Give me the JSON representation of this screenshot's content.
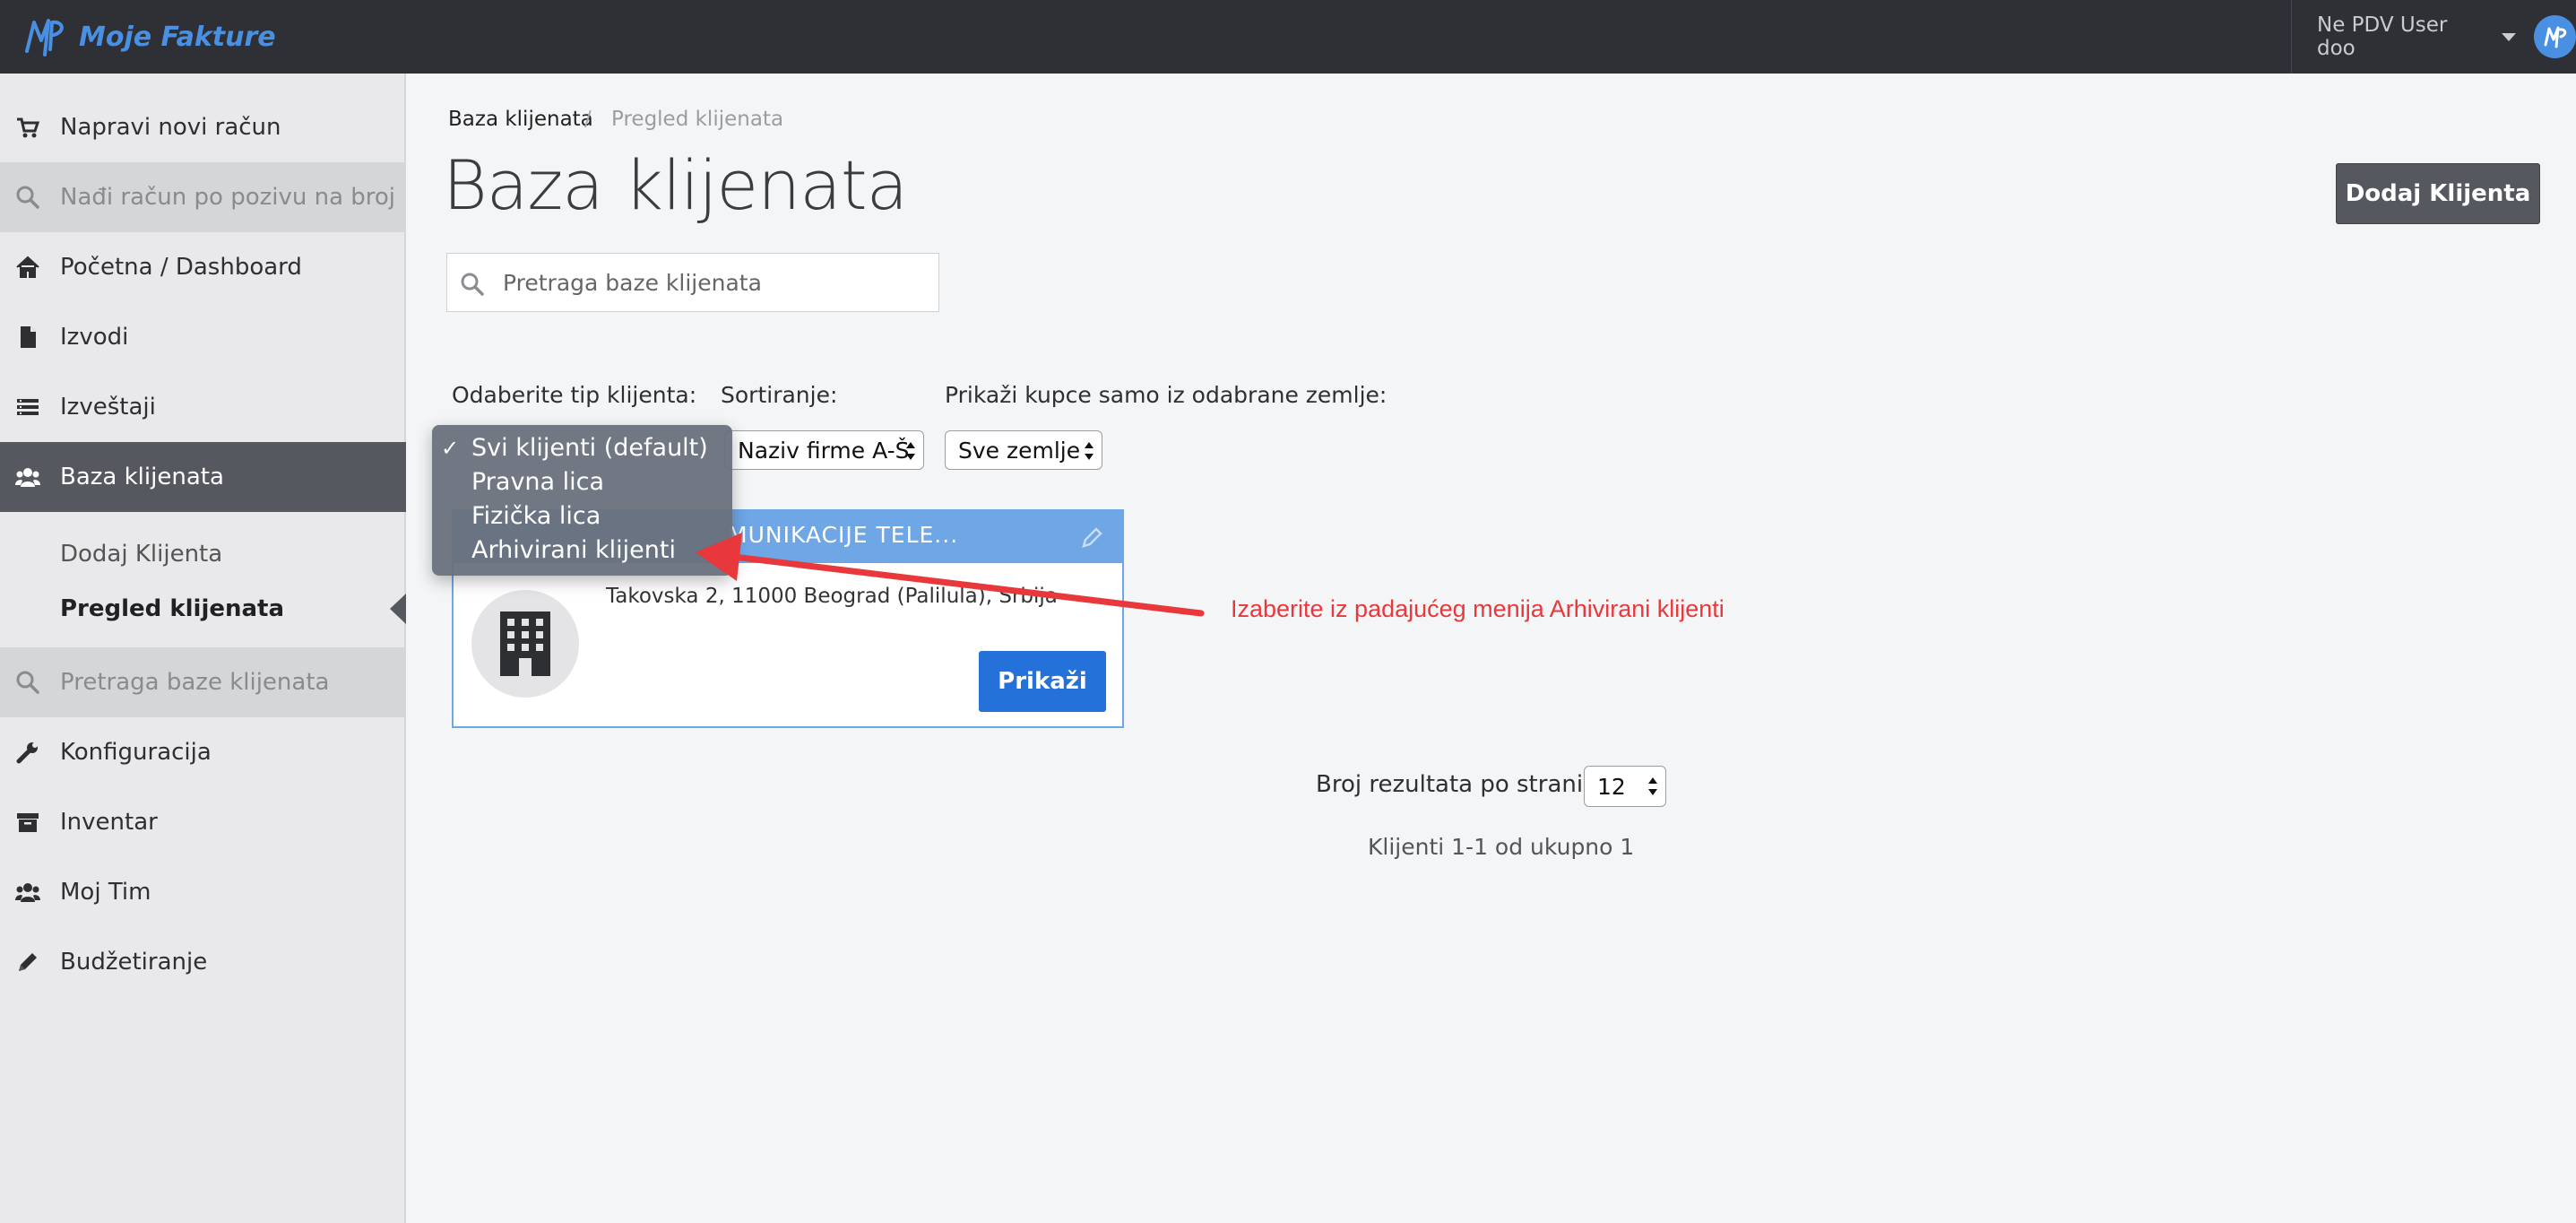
{
  "app": {
    "name": "Moje Fakture",
    "user": "Ne PDV User doo"
  },
  "sidebar": {
    "items": [
      {
        "label": "Napravi novi račun",
        "icon": "cart-icon"
      },
      {
        "label": "Nađi račun po pozivu na broj",
        "icon": "search-icon"
      },
      {
        "label": "Početna / Dashboard",
        "icon": "home-icon"
      },
      {
        "label": "Izvodi",
        "icon": "file-icon"
      },
      {
        "label": "Izveštaji",
        "icon": "list-icon"
      },
      {
        "label": "Baza klijenata",
        "icon": "users-icon"
      },
      {
        "label": "Pretraga baze klijenata",
        "icon": "search-icon"
      },
      {
        "label": "Konfiguracija",
        "icon": "wrench-icon"
      },
      {
        "label": "Inventar",
        "icon": "archive-icon"
      },
      {
        "label": "Moj Tim",
        "icon": "users-icon"
      },
      {
        "label": "Budžetiranje",
        "icon": "pencil-icon"
      }
    ],
    "sub_items": [
      "Dodaj Klijenta",
      "Pregled klijenata"
    ]
  },
  "breadcrumb": {
    "parent": "Baza klijenata",
    "separator": "/",
    "current": "Pregled klijenata"
  },
  "page": {
    "title": "Baza klijenata",
    "add_button": "Dodaj Klijenta"
  },
  "search": {
    "placeholder": "Pretraga baze klijenata"
  },
  "filters": {
    "type_label": "Odaberite tip klijenta:",
    "sort_label": "Sortiranje:",
    "sort_value": "Naziv firme A-Š",
    "country_label": "Prikaži kupce samo iz odabrane zemlje:",
    "country_value": "Sve zemlje"
  },
  "dropdown": {
    "options": [
      "Svi klijenti (default)",
      "Pravna lica",
      "Fizička lica",
      "Arhivirani klijenti"
    ],
    "selected_index": 0,
    "checkmark": "✓"
  },
  "client_card": {
    "name": "MUNIKACIJE TELE...",
    "address": "Takovska 2, 11000 Beograd (Palilula), Srbija",
    "button": "Prikaži"
  },
  "annotation": {
    "text": "Izaberite iz padajućeg menija Arhivirani klijenti",
    "color": "#e8383b"
  },
  "pagination": {
    "per_page_label": "Broj rezultata po stranici",
    "per_page_value": "12",
    "results": "Klijenti 1-1 od ukupno 1"
  },
  "colors": {
    "topbar": "#2e3035",
    "accent": "#4a90e2",
    "card_header": "#6ea6e6",
    "primary_button": "#2472d9",
    "active_nav": "#55595f"
  }
}
